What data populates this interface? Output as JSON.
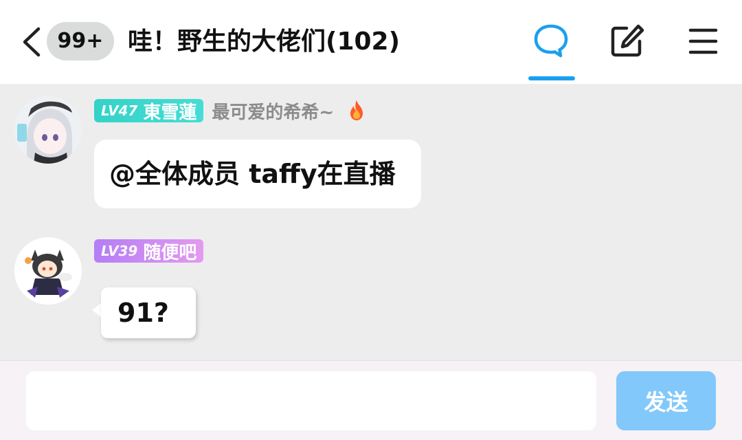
{
  "header": {
    "unread_count": "99+",
    "title": "哇！野生的大佬们(102)",
    "icons": [
      "back-icon",
      "chat-bubble-icon",
      "edit-icon",
      "menu-icon"
    ],
    "accent_color": "#1aa0ee"
  },
  "messages": [
    {
      "level": "LV47",
      "sender": "東雪蓮",
      "member_title": "最可爱的希希~",
      "badge_icon": "fire-icon",
      "tag_color": "#3ad6cc",
      "text": "@全体成员 taffy在直播"
    },
    {
      "level": "LV39",
      "sender": "随便吧",
      "tag_color": "#c88af3",
      "text": "91?"
    }
  ],
  "input": {
    "placeholder": "",
    "value": "",
    "send_label": "发送",
    "send_color": "#82c8fb"
  }
}
